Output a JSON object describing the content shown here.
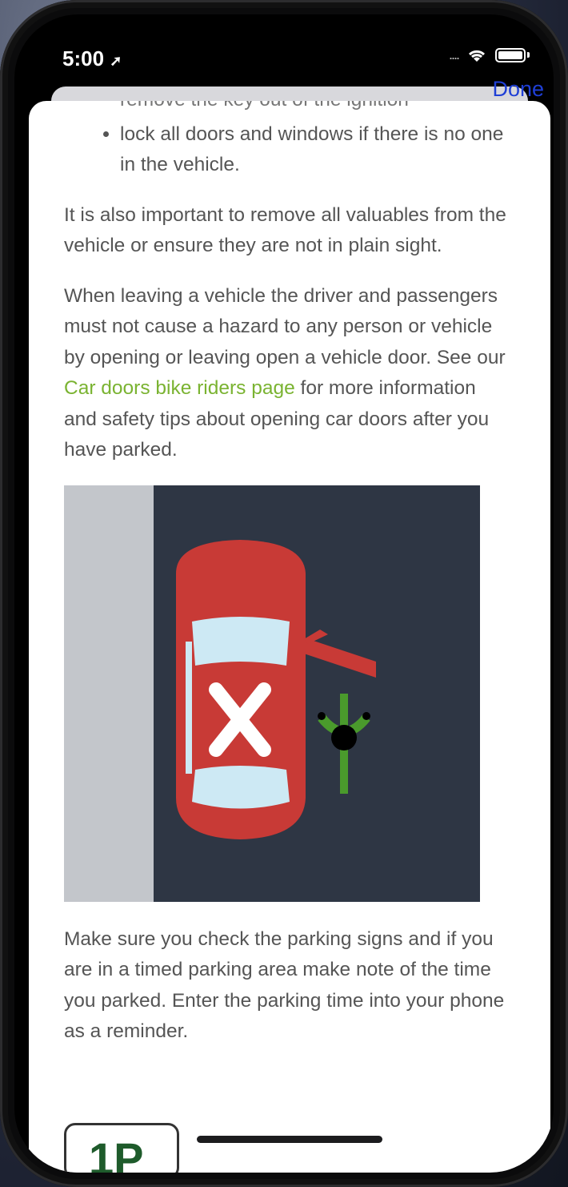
{
  "status_bar": {
    "time": "5:00"
  },
  "navigation": {
    "done_label": "Done"
  },
  "article": {
    "cut_line": "remove the key out of the ignition",
    "bullet": "lock all doors and windows if there is no one in the vehicle.",
    "para1": "It is also important to remove all valuables from the vehicle or ensure they are not in plain sight.",
    "para2_before": "When leaving a vehicle the driver and passengers must not cause a hazard to any person or vehicle by opening or leaving open a vehicle door. See our ",
    "para2_link": "Car doors bike riders page",
    "para2_after": " for more information and safety tips about opening car doors after you have parked.",
    "para3": "Make sure you check the parking signs and if you are in a timed parking area make note of the time you parked. Enter the parking time into your phone as a reminder.",
    "sign_peek": "1P"
  },
  "colors": {
    "link": "#7ab331",
    "done": "#1f3fd6",
    "car": "#c83a36",
    "road": "#2e3644",
    "bike": "#4a9a2c"
  },
  "icons": {
    "illustration": "car-door-cyclist-warning",
    "signal": "wifi-icon",
    "battery": "battery-icon",
    "location": "location-arrow-icon"
  }
}
